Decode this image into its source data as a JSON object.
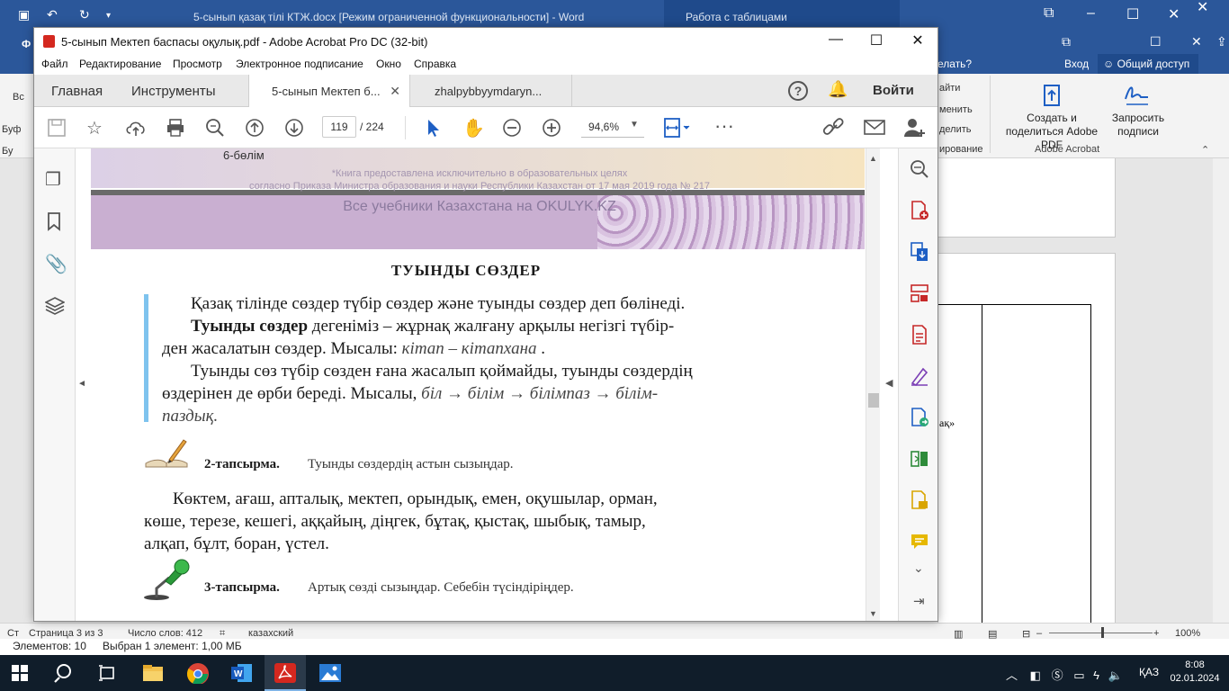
{
  "word": {
    "title": "5-сынып қазақ тілі КТЖ.docx [Режим ограниченной функциональности] - Word",
    "table_tools": "Работа с таблицами",
    "tell_me": "елать?",
    "enter": "Вход",
    "share": "Общий доступ",
    "ribbon_items": [
      "айти",
      "менить",
      "делить",
      "ирование"
    ],
    "left_stub": [
      "Ф",
      "Вс",
      "Буф",
      "Бу"
    ],
    "adobe_create": "Создать и поделиться Adobe PDF",
    "adobe_request": "Запросить подписи",
    "adobe_group": "Adobe Acrobat",
    "doc_snippet": "ақ»",
    "status_page": "Страница 3 из 3",
    "status_words": "Число слов: 412",
    "status_lang": "казахский",
    "status_zoom": "100%",
    "status_stub": "Ст",
    "explorer_items": "Элементов: 10",
    "explorer_selected": "Выбран 1 элемент: 1,00 МБ"
  },
  "acrobat": {
    "title": "5-сынып Мектеп баспасы оқулық.pdf - Adobe Acrobat Pro DC (32-bit)",
    "menu": [
      "Файл",
      "Редактирование",
      "Просмотр",
      "Электронное подписание",
      "Окно",
      "Справка"
    ],
    "nav_tabs": [
      "Главная",
      "Инструменты"
    ],
    "doc_tabs": [
      "5-сынып Мектеп б...",
      "zhalpybbyymdaryn..."
    ],
    "sign_in": "Войти",
    "page_current": "119",
    "page_total": "/ 224",
    "zoom": "94,6%"
  },
  "pdf": {
    "section_label": "6-бөлім",
    "watermark_1": "*Книга предоставлена исключительно в образовательных целях",
    "watermark_2": "согласно Приказа Министра образования и науки Республики Казахстан от 17 мая 2019 года № 217",
    "watermark_3": "Все учебники Казахстана на OKULYK.KZ",
    "heading": "ТУЫНДЫ   СӨЗДЕР",
    "p1": "Қазақ  тілінде  сөздер  түбір  сөздер  және  туынды  сөздер  деп  бөлінеді.",
    "p2_bold": "Туынды сөздер",
    "p2_rest": " дегеніміз  – жұрнақ  жалғану  арқылы  негізгі  түбір-",
    "p3_a": "ден  жасалатын    сөздер.  Мысалы:  ",
    "p3_ex": "кітап   – кітапхана",
    "p3_end": "   .",
    "p4": "Туынды  сөз  түбір  сөзден  ғана  жасалып  қоймайды,   туынды   сөздердің",
    "p5_a": "өздерінен    де  өрби  береді.  Мысалы,   ",
    "p5_ex": "біл  → білім   → білімпаз    → білім-",
    "p6": "паздық.",
    "task2_label": "2-тапсырма.",
    "task2_text": "Туынды   сөздердің   астын   сызыңдар.",
    "list_line1": "Көктем,  ағаш,  апталық,  мектеп,  орындық,  емен,  оқушылар,   орман,",
    "list_line2": "көше,  терезе,  кешегі,  аққайың,   діңгек,  бұтақ,  қыстақ,   шыбық,   тамыр,",
    "list_line3": "алқап,   бұлт,   боран,   үстел.",
    "task3_label": "3-тапсырма.",
    "task3_text": "Артық   сөзді   сызыңдар.   Себебін   түсіндіріңдер."
  },
  "tray": {
    "lang": "ҚАЗ",
    "time": "8:08",
    "date": "02.01.2024"
  },
  "colors": {
    "word_blue": "#2b579a",
    "taskbar": "#101d2a",
    "acrobat_red": "#d4281f",
    "tools_accent": "#c62828",
    "blue_accent": "#1e5fc4"
  }
}
